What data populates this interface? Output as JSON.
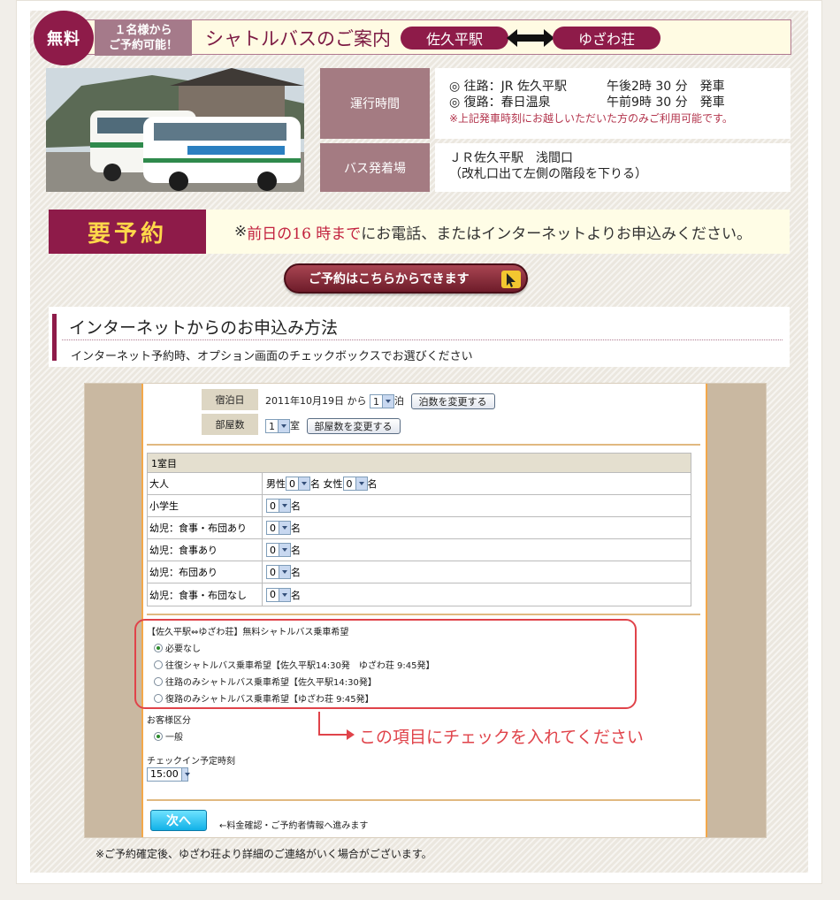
{
  "header": {
    "free": "無料",
    "one_person": [
      "１名様から",
      "ご予約可能！"
    ],
    "title": "シャトルバスのご案内",
    "from": "佐久平駅",
    "to": "ゆざわ荘"
  },
  "info": {
    "time_label": "運行時間",
    "time_rows": [
      {
        "route": "◎ 往路：JR 佐久平駅",
        "time": "午後2時 30 分　発車"
      },
      {
        "route": "◎ 復路：春日温泉",
        "time": "午前9時 30 分　発車"
      }
    ],
    "time_note": "※上記発車時刻にお越しいただいた方のみご利用可能です。",
    "stop_label": "バス発着場",
    "stop_lines": [
      "ＪＲ佐久平駅　浅間口",
      "（改札口出て左側の階段を下りる）"
    ]
  },
  "reservation": {
    "required": "要予約",
    "msg_prefix": "※",
    "msg_red": "前日の16 時まで",
    "msg_rest": "にお電話、またはインターネットよりお申込みください。",
    "button": "ご予約はこちらからできます"
  },
  "section": {
    "title": "インターネットからのお申込み方法",
    "subtitle": "インターネット予約時、オプション画面のチェックボックスでお選びください"
  },
  "form": {
    "stay_label": "宿泊日",
    "stay_date": "2011年10月19日 から",
    "stay_nights": "1",
    "stay_unit": "泊",
    "stay_button": "泊数を変更する",
    "room_label": "部屋数",
    "room_count": "1",
    "room_unit": "室",
    "room_button": "部屋数を変更する",
    "room_head": "1室目",
    "rows": [
      {
        "label": "大人",
        "male": "男性",
        "male_val": "0",
        "female": "女性",
        "female_val": "0",
        "unit": "名"
      },
      {
        "label": "小学生",
        "val": "0",
        "unit": "名"
      },
      {
        "label": "幼児：食事・布団あり",
        "val": "0",
        "unit": "名"
      },
      {
        "label": "幼児：食事あり",
        "val": "0",
        "unit": "名"
      },
      {
        "label": "幼児：布団あり",
        "val": "0",
        "unit": "名"
      },
      {
        "label": "幼児：食事・布団なし",
        "val": "0",
        "unit": "名"
      }
    ],
    "shuttle_title": "【佐久平駅⇔ゆざわ荘】無料シャトルバス乗車希望",
    "shuttle_options": [
      "必要なし",
      "往復シャトルバス乗車希望【佐久平駅14:30発　ゆざわ荘 9:45発】",
      "往路のみシャトルバス乗車希望【佐久平駅14:30発】",
      "復路のみシャトルバス乗車希望【ゆざわ荘 9:45発】"
    ],
    "customer_label": "お客様区分",
    "customer_option": "一般",
    "checkin_label": "チェックイン予定時刻",
    "checkin_value": "15:00",
    "next_button": "次へ",
    "next_hint": "←料金確認・ご予約者情報へ進みます",
    "callout": "この項目にチェックを入れてください"
  },
  "footnote": "※ご予約確定後、ゆざわ荘より詳細のご連絡がいく場合がございます。"
}
